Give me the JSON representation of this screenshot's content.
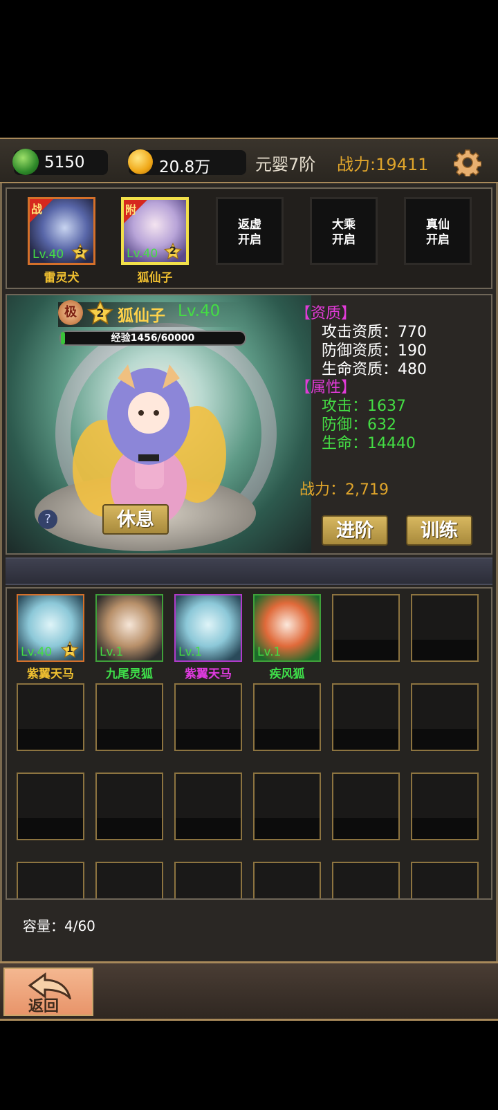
{
  "top_bar": {
    "jade": "5150",
    "gold": "20.8万",
    "realm": "元婴7阶",
    "power": "战力:19411"
  },
  "team": [
    {
      "name": "雷灵犬",
      "level": "Lv.40",
      "stars": "3",
      "tag": "战",
      "name_color": "#f0c030"
    },
    {
      "name": "狐仙子",
      "level": "Lv.40",
      "stars": "2",
      "tag": "附",
      "name_color": "#f0c030"
    }
  ],
  "locked_slots": [
    {
      "line1": "返虚",
      "line2": "开启"
    },
    {
      "line1": "大乘",
      "line2": "开启"
    },
    {
      "line1": "真仙",
      "line2": "开启"
    }
  ],
  "hero": {
    "badge": "极",
    "stars": "2",
    "name": "狐仙子",
    "level": "Lv.40",
    "exp_text": "经验1456/60000",
    "exp_ratio": 0.024,
    "aptitude_header": "【资质】",
    "aptitude": [
      {
        "label": "攻击资质：",
        "value": "770"
      },
      {
        "label": "防御资质：",
        "value": "190"
      },
      {
        "label": "生命资质：",
        "value": "480"
      }
    ],
    "attr_header": "【属性】",
    "attributes": [
      {
        "label": "攻击：",
        "value": "1637"
      },
      {
        "label": "防御：",
        "value": "632"
      },
      {
        "label": "生命：",
        "value": "14440"
      }
    ],
    "power": "战力：2,719",
    "buttons": {
      "rest": "休息",
      "advance": "进阶",
      "train": "训练"
    },
    "help": "?"
  },
  "bag": {
    "pets": [
      {
        "name": "紫翼天马",
        "level": "Lv.40",
        "stars": "1",
        "name_color": "#f0c030",
        "border": "#d5702a"
      },
      {
        "name": "九尾灵狐",
        "level": "Lv.1",
        "stars": "",
        "name_color": "#3fe04a",
        "border": "#3fa03a"
      },
      {
        "name": "紫翼天马",
        "level": "Lv.1",
        "stars": "",
        "name_color": "#e03be0",
        "border": "#b03ac8"
      },
      {
        "name": "疾风狐",
        "level": "Lv.1",
        "stars": "",
        "name_color": "#3fe04a",
        "border": "#3fa03a"
      }
    ],
    "capacity": "容量：4/60"
  },
  "back_label": "返回",
  "colors": {
    "accent_gold": "#e0a52b",
    "green": "#44dd44",
    "magenta": "#e13bd8"
  }
}
